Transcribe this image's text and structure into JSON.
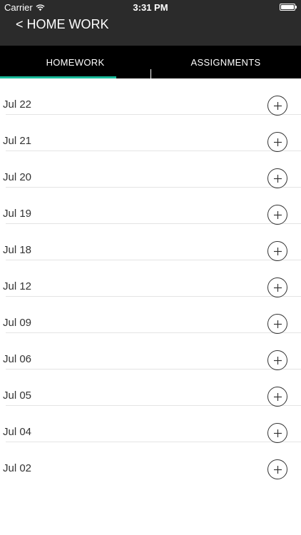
{
  "status_bar": {
    "carrier": "Carrier",
    "time": "3:31 PM",
    "battery_level": 1.0
  },
  "nav": {
    "back_label": "< HOME WORK"
  },
  "tabs": [
    {
      "label": "HOMEWORK",
      "selected": true
    },
    {
      "label": "ASSIGNMENTS",
      "selected": false
    }
  ],
  "colors": {
    "status_bar_bg": "#2b2b2b",
    "tabs_bg": "#000000",
    "tab_accent": "#1abc9c"
  },
  "list": {
    "items": [
      {
        "date": "Jul 22",
        "action_icon": "plus-circle-icon"
      },
      {
        "date": "Jul 21",
        "action_icon": "plus-circle-icon"
      },
      {
        "date": "Jul 20",
        "action_icon": "plus-circle-icon"
      },
      {
        "date": "Jul 19",
        "action_icon": "plus-circle-icon"
      },
      {
        "date": "Jul 18",
        "action_icon": "plus-circle-icon"
      },
      {
        "date": "Jul 12",
        "action_icon": "plus-circle-icon"
      },
      {
        "date": "Jul 09",
        "action_icon": "plus-circle-icon"
      },
      {
        "date": "Jul 06",
        "action_icon": "plus-circle-icon"
      },
      {
        "date": "Jul 05",
        "action_icon": "plus-circle-icon"
      },
      {
        "date": "Jul 04",
        "action_icon": "plus-circle-icon"
      },
      {
        "date": "Jul 02",
        "action_icon": "plus-circle-icon"
      }
    ]
  }
}
